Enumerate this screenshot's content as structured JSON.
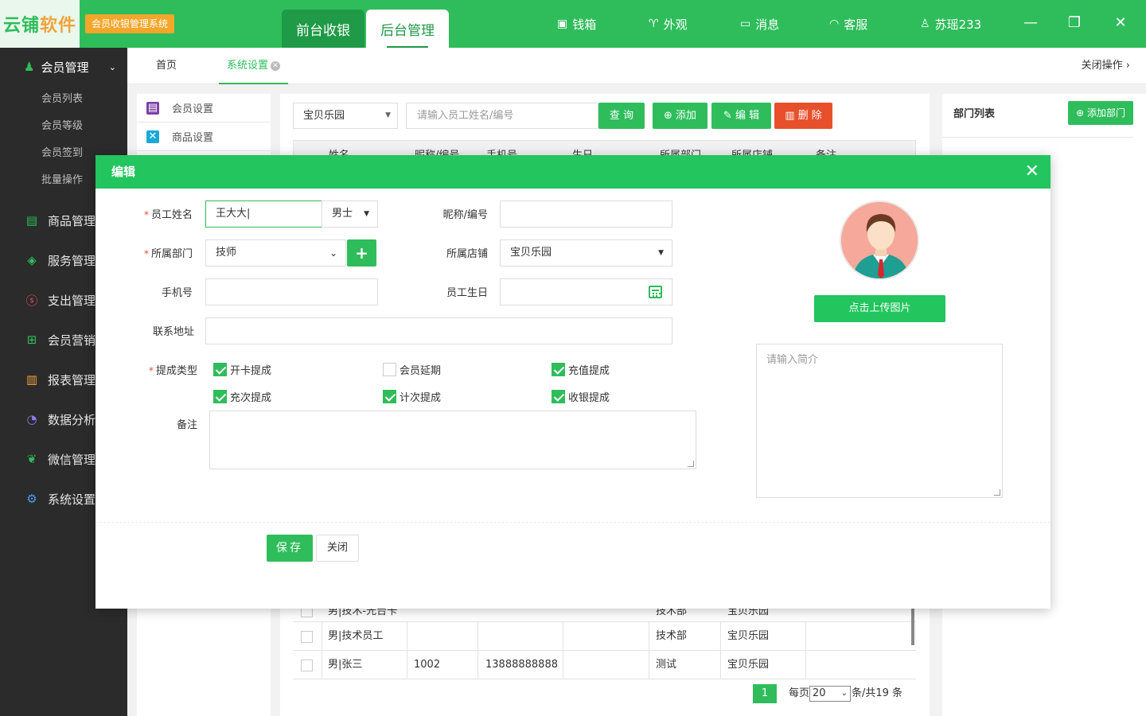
{
  "app": {
    "logo_main": "云铺",
    "logo_accent": "软件",
    "system_badge": "会员收银管理系统"
  },
  "top_tabs": {
    "front": "前台收银",
    "back": "后台管理"
  },
  "top_nav": [
    {
      "label": "钱箱",
      "icon": "cash-box-icon"
    },
    {
      "label": "外观",
      "icon": "tshirt-icon"
    },
    {
      "label": "消息",
      "icon": "message-icon"
    },
    {
      "label": "客服",
      "icon": "headset-icon"
    },
    {
      "label": "苏瑶233",
      "icon": "user-icon"
    }
  ],
  "sidebar": {
    "head": "会员管理",
    "sub_items": [
      "会员列表",
      "会员等级",
      "会员签到",
      "批量操作"
    ],
    "items": [
      {
        "label": "商品管理",
        "icon": "goods-icon"
      },
      {
        "label": "服务管理",
        "icon": "service-icon"
      },
      {
        "label": "支出管理",
        "icon": "expense-icon"
      },
      {
        "label": "会员营销",
        "icon": "gift-icon"
      },
      {
        "label": "报表管理",
        "icon": "report-icon"
      },
      {
        "label": "数据分析",
        "icon": "pie-chart-icon"
      },
      {
        "label": "微信管理",
        "icon": "wechat-icon"
      },
      {
        "label": "系统设置",
        "icon": "settings-icon"
      }
    ]
  },
  "crumbs": {
    "home": "首页",
    "current": "系统设置",
    "close_ops": "关闭操作"
  },
  "settings_menu": [
    "会员设置",
    "商品设置"
  ],
  "toolbar": {
    "store": "宝贝乐园",
    "search_placeholder": "请输入员工姓名/编号",
    "query": "查 询",
    "add": "添加",
    "edit": "编 辑",
    "delete": "删 除"
  },
  "table": {
    "headers": [
      "姓名",
      "昵称/编号",
      "手机号",
      "生日",
      "所属部门",
      "所属店铺",
      "备注"
    ],
    "rows": [
      {
        "name": "男|技术员工",
        "code": "",
        "phone": "",
        "birthday": "",
        "dept": "技术部",
        "store": "宝贝乐园",
        "note": ""
      },
      {
        "name": "男|张三",
        "code": "1002",
        "phone": "13888888888",
        "birthday": "",
        "dept": "测试",
        "store": "宝贝乐园",
        "note": ""
      }
    ],
    "partial_row": {
      "name": "男|技术-光台卡",
      "dept": "技术部",
      "store": "宝贝乐园"
    }
  },
  "pager": {
    "page": "1",
    "per_page_label": "每页",
    "per_page": "20",
    "total": "条/共19 条"
  },
  "dept_panel": {
    "title": "部门列表",
    "add_btn": "添加部门"
  },
  "modal": {
    "title": "编辑",
    "name_label": "员工姓名",
    "name_value": "王大大",
    "gender": "男士",
    "nick_label": "昵称/编号",
    "nick_value": "",
    "dept_label": "所属部门",
    "dept_value": "技师",
    "store_label": "所属店铺",
    "store_value": "宝贝乐园",
    "phone_label": "手机号",
    "phone_value": "",
    "birthday_label": "员工生日",
    "birthday_value": "",
    "address_label": "联系地址",
    "address_value": "",
    "commission_label": "提成类型",
    "commissions": [
      {
        "label": "开卡提成",
        "checked": true
      },
      {
        "label": "会员延期",
        "checked": false
      },
      {
        "label": "充值提成",
        "checked": true
      },
      {
        "label": "充次提成",
        "checked": true
      },
      {
        "label": "计次提成",
        "checked": true
      },
      {
        "label": "收银提成",
        "checked": true
      }
    ],
    "remark_label": "备注",
    "upload_btn": "点击上传图片",
    "intro_placeholder": "请输入简介",
    "save": "保存",
    "close": "关闭"
  },
  "colors": {
    "primary": "#2fbd5b",
    "header": "#22c55e",
    "danger": "#e8502c",
    "badge": "#f4a62a",
    "sidebar": "#2b2b2b"
  }
}
